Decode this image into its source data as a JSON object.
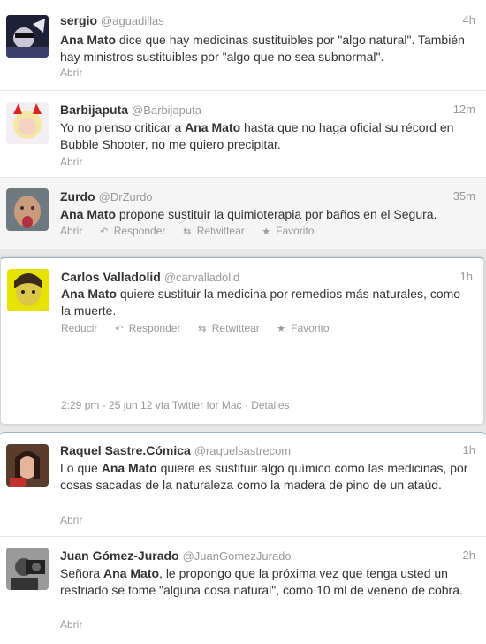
{
  "tweets": [
    {
      "fullname": "sergio",
      "username": "@aguadillas",
      "time": "4h",
      "text_parts": [
        {
          "b": true,
          "t": "Ana Mato"
        },
        {
          "b": false,
          "t": " dice que hay medicinas sustituibles por \"algo natural\". También hay ministros sustituibles por \"algo que no sea subnormal\"."
        }
      ],
      "actions": [
        "Abrir"
      ]
    },
    {
      "fullname": "Barbijaputa",
      "username": "@Barbijaputa",
      "time": "12m",
      "text_parts": [
        {
          "b": false,
          "t": "Yo no pienso criticar a "
        },
        {
          "b": true,
          "t": "Ana Mato"
        },
        {
          "b": false,
          "t": " hasta que no haga oficial su récord en Bubble Shooter, no me quiero precipitar."
        }
      ],
      "actions": [
        "Abrir"
      ]
    },
    {
      "fullname": "Zurdo",
      "username": "@DrZurdo",
      "time": "35m",
      "text_parts": [
        {
          "b": true,
          "t": "Ana Mato"
        },
        {
          "b": false,
          "t": " propone sustituir la quimioterapia por baños en el Segura."
        }
      ],
      "actions": [
        "Abrir",
        "Responder",
        "Retwittear",
        "Favorito"
      ]
    },
    {
      "fullname": "Carlos Valladolid",
      "username": "@carvalladolid",
      "time": "1h",
      "text_parts": [
        {
          "b": true,
          "t": "Ana Mato"
        },
        {
          "b": false,
          "t": " quiere sustituir la medicina por remedios más naturales, como la muerte."
        }
      ],
      "actions": [
        "Reducir",
        "Responder",
        "Retwittear",
        "Favorito"
      ],
      "meta": "2:29 pm - 25 jun 12 vía Twitter for Mac · Detalles"
    },
    {
      "fullname": "Raquel Sastre.Cómica",
      "username": "@raquelsastrecom",
      "time": "1h",
      "text_parts": [
        {
          "b": false,
          "t": "Lo que "
        },
        {
          "b": true,
          "t": "Ana Mato"
        },
        {
          "b": false,
          "t": " quiere es sustituir algo químico como las medicinas, por cosas sacadas de la naturaleza como la madera de pino de un ataúd."
        }
      ],
      "actions": [
        "Abrir"
      ]
    },
    {
      "fullname": "Juan Gómez-Jurado",
      "username": "@JuanGomezJurado",
      "time": "2h",
      "text_parts": [
        {
          "b": false,
          "t": "Señora "
        },
        {
          "b": true,
          "t": "Ana Mato"
        },
        {
          "b": false,
          "t": ", le propongo que la próxima vez que tenga usted un resfriado se tome \"alguna cosa natural\", como 10 ml de veneno de cobra."
        }
      ],
      "actions": [
        "Abrir"
      ]
    }
  ],
  "icons": {
    "reply": "reply-icon",
    "retweet": "retweet-icon",
    "favorite": "star-icon"
  }
}
